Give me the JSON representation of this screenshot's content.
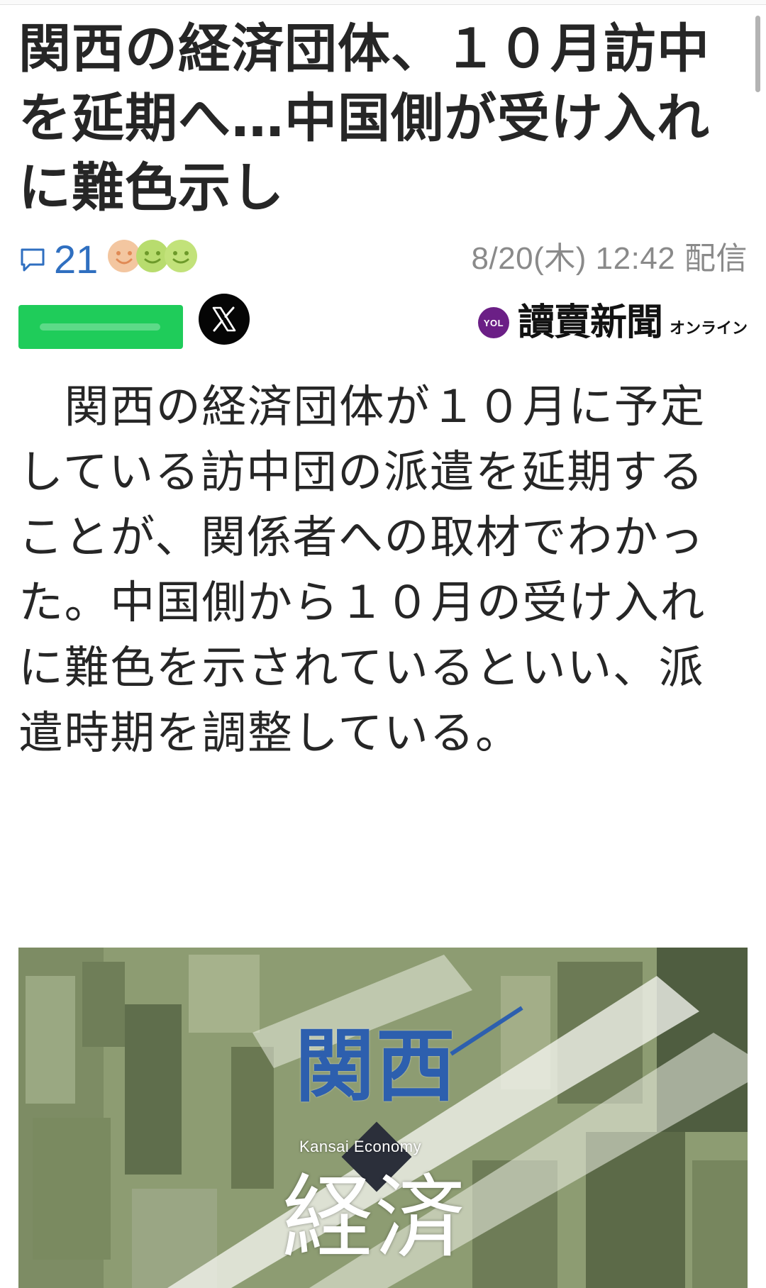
{
  "article": {
    "headline": "関西の経済団体、１０月訪中を延期へ…中国側が受け入れに難色示し",
    "comment_count": "21",
    "published": "8/20(木) 12:42 配信",
    "body": "　関西の経済団体が１０月に予定している訪中団の派遣を延期することが、関係者への取材でわかった。中国側から１０月の受け入れに難色を示されているといい、派遣時期を調整している。"
  },
  "reactions": {
    "faces": [
      {
        "icon": "happy-face-icon",
        "color": "#f3c6a0"
      },
      {
        "icon": "smile-face-icon",
        "color": "#b8dc6e"
      },
      {
        "icon": "smile-face-icon",
        "color": "#c2e27a"
      }
    ]
  },
  "share": {
    "line_color": "#1fcc5a",
    "x_icon": "x-logo-icon"
  },
  "publisher": {
    "badge": "YOL",
    "name": "讀賣新聞",
    "suffix": "オンライン",
    "brand_color": "#6b1f86"
  },
  "figure": {
    "title": "関西",
    "caption": "Kansai Economy",
    "title2": "経済"
  },
  "colors": {
    "accent": "#2f6fc0",
    "date": "#8a8a8a",
    "text": "#262626"
  }
}
